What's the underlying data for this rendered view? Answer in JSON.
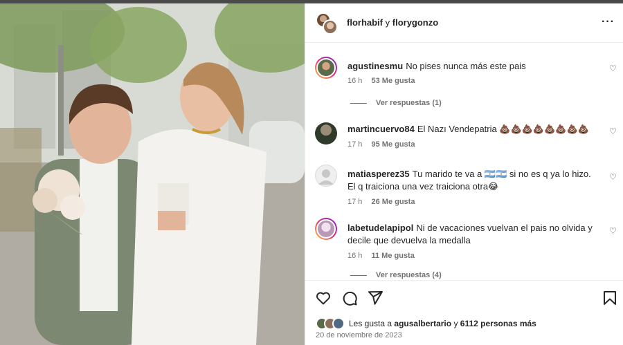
{
  "header": {
    "user1": "florhabif",
    "conj": "y",
    "user2": "florygonzo",
    "more_icon": "more-horizontal-icon"
  },
  "comments": [
    {
      "user": "agustinesmu",
      "text": "No pises nunca más este pais",
      "time": "16 h",
      "likes": "53 Me gusta",
      "replies": "Ver respuestas (1)",
      "avatar_color": "#5a6b4a"
    },
    {
      "user": "martincuervo84",
      "text": "El Nazı Vendepatria 💩💩💩💩💩💩💩💩",
      "time": "17 h",
      "likes": "95 Me gusta",
      "avatar_color": "#2f3a2a"
    },
    {
      "user": "matiasperez35",
      "text": "Tu marido te va a 🇦🇷🇦🇷 si no es q ya lo hizo. El q traiciona una vez traiciona otra😂",
      "time": "17 h",
      "likes": "26 Me gusta",
      "avatar_color": "#dbdbdb"
    },
    {
      "user": "labetudelapipol",
      "text": "Ni de vacaciones vuelvan el pais no olvida y decile que devuelva la medalla",
      "time": "16 h",
      "likes": "11 Me gusta",
      "replies": "Ver respuestas (4)",
      "avatar_color": "#e8d9e8"
    }
  ],
  "actions": {
    "like_icon": "heart-icon",
    "comment_icon": "comment-icon",
    "share_icon": "send-icon",
    "save_icon": "bookmark-icon"
  },
  "likes_summary": {
    "prefix": "Les gusta a",
    "user": "agusalbertario",
    "conj": "y",
    "count": "6112 personas más"
  },
  "date": "20 de noviembre de 2023",
  "colors": {
    "text": "#262626",
    "secondary": "#737373",
    "divider": "#efefef",
    "story_ring_start": "#f9ce34",
    "story_ring_end": "#6228d7"
  }
}
